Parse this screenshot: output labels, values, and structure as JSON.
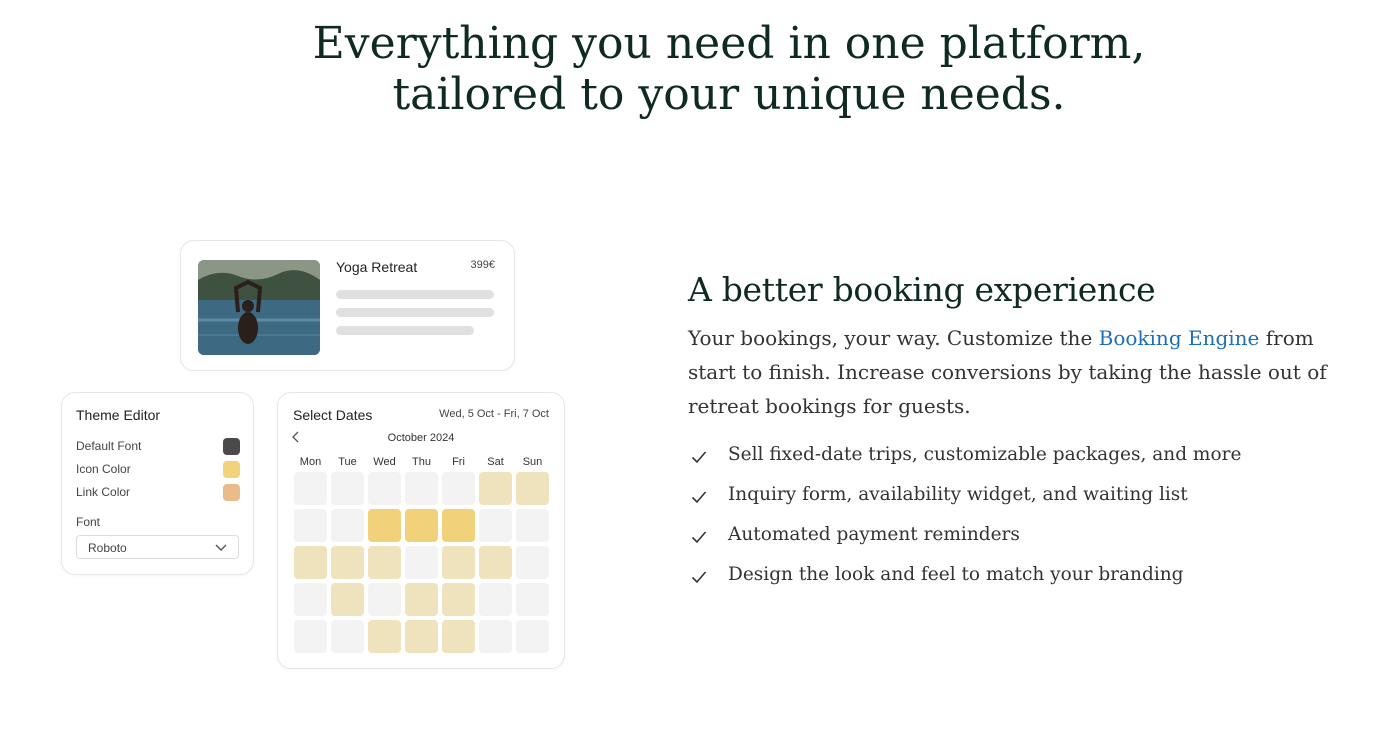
{
  "hero": {
    "title_line1": "Everything you need in one platform,",
    "title_line2": "tailored to your unique needs."
  },
  "product_card": {
    "title": "Yoga Retreat",
    "price": "399€"
  },
  "theme_editor": {
    "title": "Theme Editor",
    "rows": [
      {
        "label": "Default Font",
        "color": "#4a4a4a"
      },
      {
        "label": "Icon Color",
        "color": "#f2d27a"
      },
      {
        "label": "Link Color",
        "color": "#e9bb8a"
      }
    ],
    "font_label": "Font",
    "font_value": "Roboto"
  },
  "calendar": {
    "title": "Select Dates",
    "range": "Wed, 5 Oct - Fri, 7 Oct",
    "month": "October 2024",
    "days": [
      "Mon",
      "Tue",
      "Wed",
      "Thu",
      "Fri",
      "Sat",
      "Sun"
    ],
    "grid": [
      [
        0,
        0,
        0,
        0,
        0,
        1,
        1
      ],
      [
        0,
        0,
        2,
        2,
        2,
        0,
        0
      ],
      [
        1,
        1,
        1,
        0,
        1,
        1,
        0
      ],
      [
        0,
        1,
        0,
        1,
        1,
        0,
        0
      ],
      [
        0,
        0,
        1,
        1,
        1,
        0,
        0
      ]
    ],
    "colors": {
      "empty": "#f3f3f3",
      "available": "#efe3be",
      "selected": "#f1d27a"
    }
  },
  "feature": {
    "heading": "A better booking experience",
    "desc_before": "Your bookings, your way. Customize the ",
    "desc_link": "Booking Engine",
    "desc_after": " from start to finish. Increase conversions by taking the hassle out of retreat bookings for guests.",
    "items": [
      "Sell fixed-date trips, customizable packages, and more",
      "Inquiry form, availability widget, and waiting list",
      "Automated payment reminders",
      "Design the look and feel to match your branding"
    ]
  }
}
